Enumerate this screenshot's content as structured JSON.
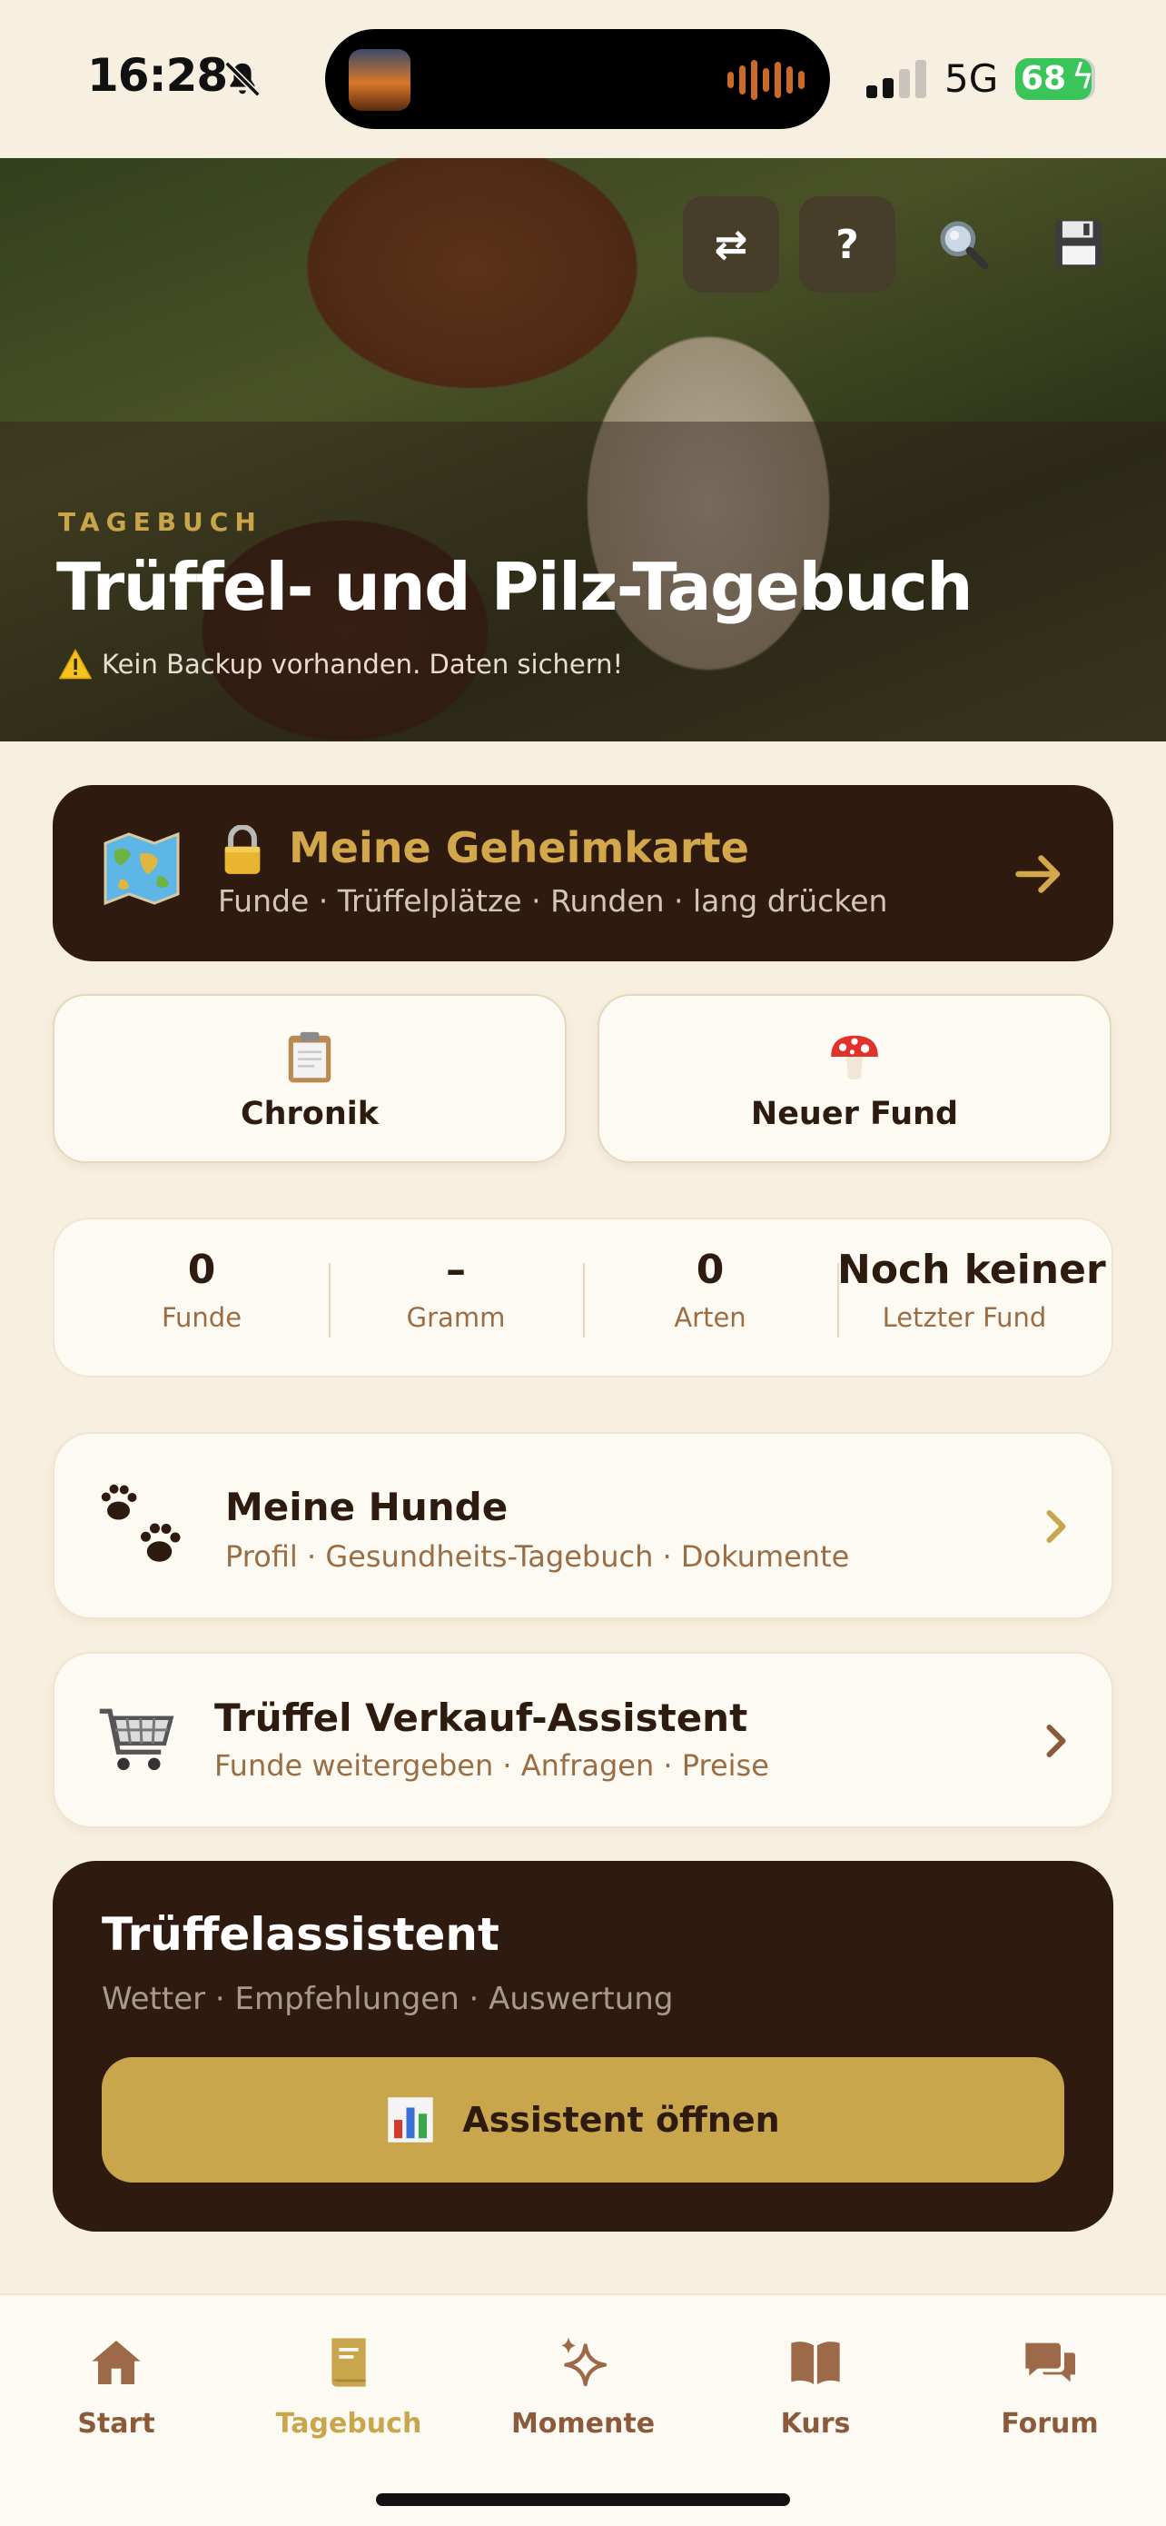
{
  "status_bar": {
    "time": "16:28",
    "network": "5G",
    "battery": "68"
  },
  "hero": {
    "kicker": "TAGEBUCH",
    "title": "Trüffel- und Pilz-Tagebuch",
    "warning": "Kein Backup vorhanden. Daten sichern!",
    "buttons": {
      "swap": "⇄",
      "help": "?"
    }
  },
  "secret_map": {
    "title": "Meine Geheimkarte",
    "subtitle": "Funde · Trüffelplätze · Runden · lang drücken"
  },
  "tiles": [
    {
      "label": "Chronik"
    },
    {
      "label": "Neuer Fund"
    }
  ],
  "stats": [
    {
      "value": "0",
      "label": "Funde"
    },
    {
      "value": "–",
      "label": "Gramm"
    },
    {
      "value": "0",
      "label": "Arten"
    },
    {
      "value": "Noch keiner",
      "label": "Letzter Fund"
    }
  ],
  "dogs": {
    "title": "Meine Hunde",
    "subtitle": "Profil · Gesundheits-Tagebuch · Dokumente"
  },
  "sales": {
    "title": "Trüffel Verkauf-Assistent",
    "subtitle": "Funde weitergeben · Anfragen · Preise"
  },
  "assistant": {
    "title": "Trüffelassistent",
    "subtitle": "Wetter · Empfehlungen · Auswertung",
    "button": "Assistent öffnen"
  },
  "tabs": [
    {
      "label": "Start",
      "icon": "home-icon"
    },
    {
      "label": "Tagebuch",
      "icon": "book-icon",
      "active": true
    },
    {
      "label": "Momente",
      "icon": "sparkle-icon"
    },
    {
      "label": "Kurs",
      "icon": "open-book-icon"
    },
    {
      "label": "Forum",
      "icon": "chat-icon"
    }
  ],
  "colors": {
    "background": "#f7efdf",
    "dark_card": "#2f1a10",
    "gold": "#c9a64b",
    "brown_text": "#9a6e44",
    "tab_inactive": "#8a5a3a"
  }
}
